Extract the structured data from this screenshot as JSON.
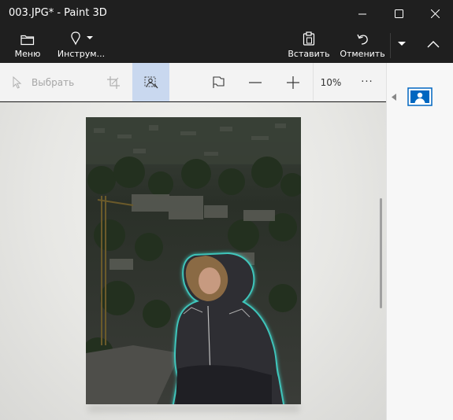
{
  "window": {
    "title": "003.JPG* - Paint 3D"
  },
  "commandbar": {
    "menu_label": "Меню",
    "tools_label": "Инструм...",
    "paste_label": "Вставить",
    "undo_label": "Отменить"
  },
  "toolbar": {
    "select_label": "Выбрать",
    "zoom_value": "10%",
    "more_glyph": "···"
  },
  "icons": {
    "menu": "folder-icon",
    "tools": "brush-icon",
    "paste": "clipboard-icon",
    "undo": "undo-icon",
    "select": "cursor-icon",
    "crop": "crop-icon",
    "magic_select": "magic-select-icon",
    "flag": "flag-icon",
    "zoom_out": "minus-icon",
    "zoom_in": "plus-icon",
    "panel_toggle": "chevron-left-icon",
    "panel": "person-image-icon"
  },
  "colors": {
    "titlebar_bg": "#1f1f1f",
    "accent": "#0067c0",
    "active_tool_bg": "#c9d8ef",
    "toolbar_bg": "#f3f3f3",
    "selection_glow": "#3fd0c6"
  }
}
